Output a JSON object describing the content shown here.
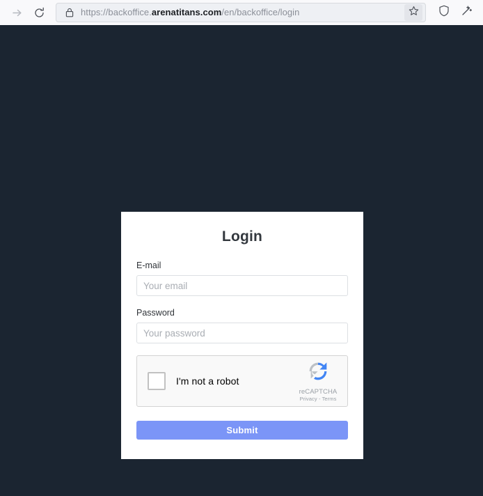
{
  "browser": {
    "nav": {
      "forward_icon": "arrow-right-icon",
      "reload_icon": "reload-icon"
    },
    "urlbar": {
      "lock_icon": "lock-icon",
      "url_prefix": "https://backoffice.",
      "url_domain": "arenatitans.com",
      "url_path": "/en/backoffice/login",
      "full_url": "https://backoffice.arenatitans.com/en/backoffice/login",
      "bookmark_icon": "star-icon"
    },
    "toolbar_icons": [
      {
        "name": "shield-icon"
      },
      {
        "name": "magic-wand-icon"
      }
    ]
  },
  "page": {
    "background_color": "#1b2531"
  },
  "login": {
    "title": "Login",
    "email": {
      "label": "E-mail",
      "placeholder": "Your email",
      "value": ""
    },
    "password": {
      "label": "Password",
      "placeholder": "Your password",
      "value": ""
    },
    "recaptcha": {
      "label": "I'm not a robot",
      "brand": "reCAPTCHA",
      "legal": "Privacy - Terms",
      "checked": false,
      "logo_blue": "#4285f4",
      "logo_gray": "#bdc1c6"
    },
    "submit": {
      "label": "Submit",
      "color": "#7b95f7"
    }
  }
}
